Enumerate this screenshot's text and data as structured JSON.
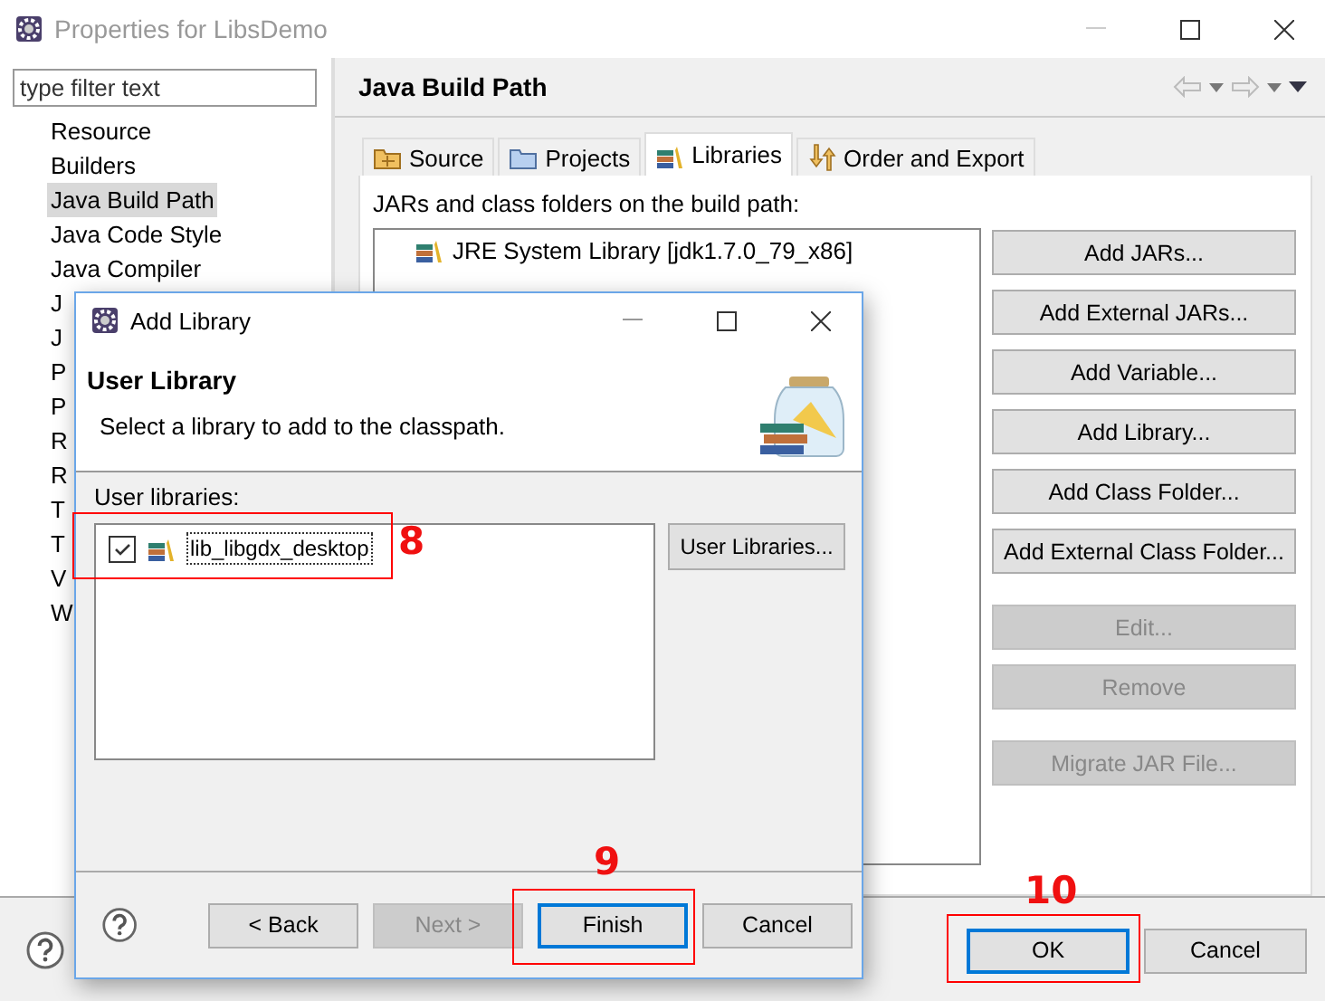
{
  "window": {
    "title": "Properties for LibsDemo"
  },
  "filter": {
    "placeholder": "type filter text"
  },
  "sidebar": {
    "items": [
      {
        "label": "Resource",
        "selected": false
      },
      {
        "label": "Builders",
        "selected": false
      },
      {
        "label": "Java Build Path",
        "selected": true
      },
      {
        "label": "Java Code Style",
        "selected": false
      },
      {
        "label": "Java Compiler",
        "selected": false
      },
      {
        "label": "J",
        "selected": false
      },
      {
        "label": "J",
        "selected": false
      },
      {
        "label": "P",
        "selected": false
      },
      {
        "label": "P",
        "selected": false
      },
      {
        "label": "R",
        "selected": false
      },
      {
        "label": "R",
        "selected": false
      },
      {
        "label": "T",
        "selected": false
      },
      {
        "label": "T",
        "selected": false
      },
      {
        "label": "V",
        "selected": false
      },
      {
        "label": "W",
        "selected": false
      }
    ]
  },
  "page": {
    "title": "Java Build Path"
  },
  "tabs": [
    {
      "label": "Source",
      "selected": false
    },
    {
      "label": "Projects",
      "selected": false
    },
    {
      "label": "Libraries",
      "selected": true
    },
    {
      "label": "Order and Export",
      "selected": false
    }
  ],
  "build_path": {
    "label": "JARs and class folders on the build path:",
    "entries": [
      "JRE System Library [jdk1.7.0_79_x86]"
    ],
    "buttons": [
      {
        "label": "Add JARs...",
        "disabled": false
      },
      {
        "label": "Add External JARs...",
        "disabled": false
      },
      {
        "label": "Add Variable...",
        "disabled": false
      },
      {
        "label": "Add Library...",
        "disabled": false
      },
      {
        "label": "Add Class Folder...",
        "disabled": false
      },
      {
        "label": "Add External Class Folder...",
        "disabled": false
      },
      {
        "label": "Edit...",
        "disabled": true
      },
      {
        "label": "Remove",
        "disabled": true
      },
      {
        "label": "Migrate JAR File...",
        "disabled": true
      }
    ]
  },
  "buttons": [
    {
      "label": "OK",
      "default": true
    },
    {
      "label": "Cancel",
      "default": false
    }
  ],
  "dialog": {
    "title": "Add Library",
    "heading": "User Library",
    "description": "Select a library to add to the classpath.",
    "list_label": "User libraries:",
    "libraries": [
      {
        "name": "lib_libgdx_desktop",
        "checked": true
      }
    ],
    "side_button": "User Libraries...",
    "buttons": [
      {
        "label": "< Back",
        "disabled": false,
        "default": false
      },
      {
        "label": "Next >",
        "disabled": true,
        "default": false
      },
      {
        "label": "Finish",
        "disabled": false,
        "default": true
      },
      {
        "label": "Cancel",
        "disabled": false,
        "default": false
      }
    ]
  },
  "annotations": [
    {
      "label": "8"
    },
    {
      "label": "9"
    },
    {
      "label": "10"
    }
  ]
}
